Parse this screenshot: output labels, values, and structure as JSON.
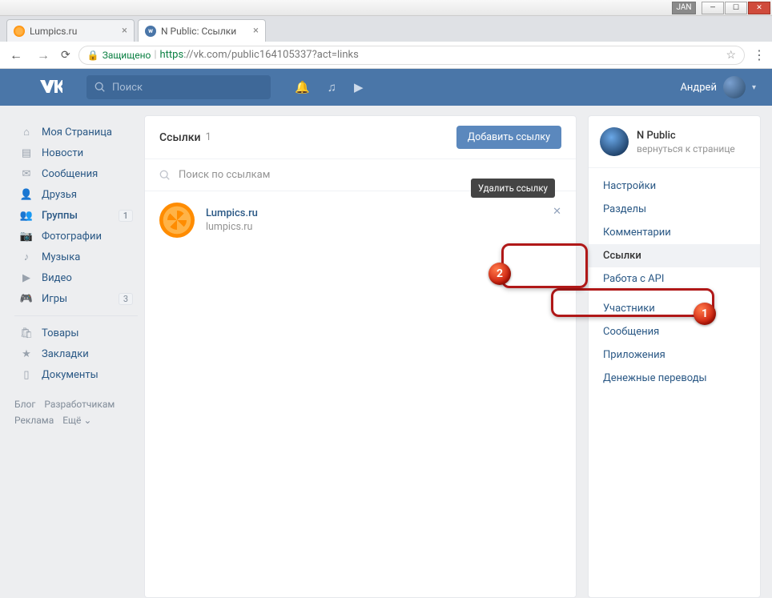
{
  "chrome": {
    "jan": "JAN",
    "min": "—",
    "max": "☐",
    "close": "✕"
  },
  "tabs": [
    {
      "title": "Lumpics.ru"
    },
    {
      "title": "N Public: Ссылки"
    }
  ],
  "addressbar": {
    "secure_label": "Защищено",
    "https": "https",
    "url": "://vk.com/public164105337?act=links"
  },
  "vk": {
    "logo": "VK",
    "search_placeholder": "Поиск",
    "username": "Андрей"
  },
  "sidebar": {
    "items": [
      {
        "label": "Моя Страница"
      },
      {
        "label": "Новости"
      },
      {
        "label": "Сообщения"
      },
      {
        "label": "Друзья"
      },
      {
        "label": "Группы",
        "badge": "1"
      },
      {
        "label": "Фотографии"
      },
      {
        "label": "Музыка"
      },
      {
        "label": "Видео"
      },
      {
        "label": "Игры",
        "badge": "3"
      }
    ],
    "items2": [
      {
        "label": "Товары"
      },
      {
        "label": "Закладки"
      },
      {
        "label": "Документы"
      }
    ],
    "footer": {
      "blog": "Блог",
      "devs": "Разработчикам",
      "ads": "Реклама",
      "more": "Ещё ⌄"
    }
  },
  "links_panel": {
    "title": "Ссылки",
    "count": "1",
    "add_button": "Добавить ссылку",
    "search_placeholder": "Поиск по ссылкам",
    "link_title": "Lumpics.ru",
    "link_url": "lumpics.ru",
    "delete_tooltip": "Удалить ссылку",
    "delete_icon": "✕"
  },
  "right_panel": {
    "group_name": "N Public",
    "group_sub": "вернуться к странице",
    "menu": [
      "Настройки",
      "Разделы",
      "Комментарии",
      "Ссылки",
      "Работа с API",
      "Участники",
      "Сообщения",
      "Приложения",
      "Денежные переводы"
    ],
    "active_index": 3
  },
  "callouts": {
    "one": "1",
    "two": "2"
  }
}
